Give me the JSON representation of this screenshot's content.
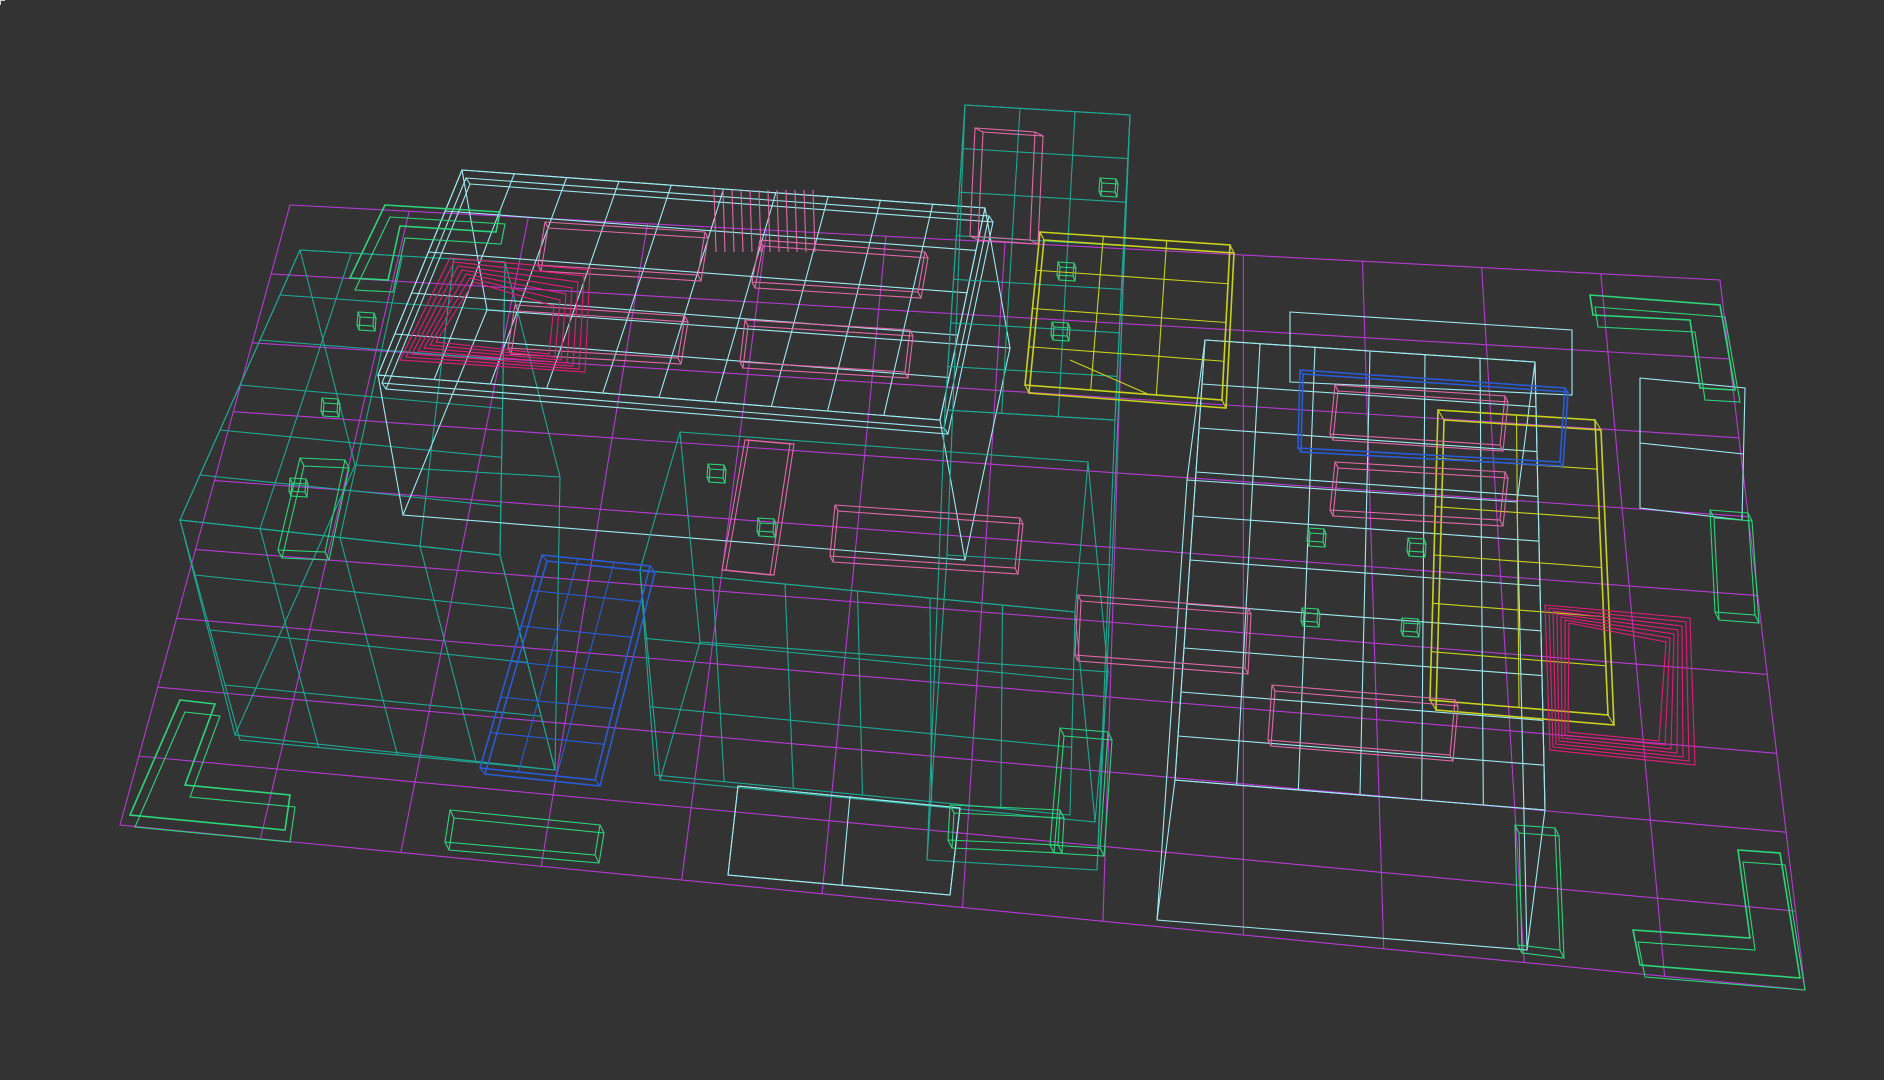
{
  "viewport": {
    "mode": "wireframe",
    "background": "#333333",
    "colors": {
      "floor": "#b43cd2",
      "walls": "#1fa894",
      "structure": "#9eeaf0",
      "furniture_pink": "#e06aa8",
      "furniture_hotpink": "#e01e7a",
      "yellow_object": "#c8d21e",
      "blue_object": "#2a5cd6",
      "green_object": "#2ed47a"
    },
    "objects": [
      {
        "name": "floor-grid-wireframe",
        "color_key": "floor"
      },
      {
        "name": "left-room-walls-wireframe",
        "color_key": "walls"
      },
      {
        "name": "upper-left-building-wireframe",
        "color_key": "structure"
      },
      {
        "name": "tall-tower-wireframe",
        "color_key": "walls"
      },
      {
        "name": "center-room-wireframe",
        "color_key": "walls"
      },
      {
        "name": "right-building-wireframe",
        "color_key": "structure"
      },
      {
        "name": "yellow-cabinet-wireframe",
        "color_key": "yellow_object"
      },
      {
        "name": "yellow-shelf-wireframe",
        "color_key": "yellow_object"
      },
      {
        "name": "blue-panel-wireframe",
        "color_key": "blue_object"
      },
      {
        "name": "pink-furniture-wireframe",
        "color_key": "furniture_pink"
      },
      {
        "name": "hotpink-staircase-wireframe",
        "color_key": "furniture_hotpink"
      },
      {
        "name": "green-l-shape-objects",
        "color_key": "green_object"
      }
    ]
  }
}
